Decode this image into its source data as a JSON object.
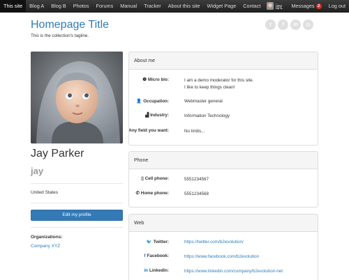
{
  "navbar": {
    "items": [
      "This site",
      "Blog A",
      "Blog B",
      "Photos",
      "Forums",
      "Manual",
      "Tracker",
      "About this site",
      "Widget Page",
      "Contact"
    ],
    "user": "jay",
    "messages_label": "Messages",
    "messages_count": "2",
    "logout": "Log out"
  },
  "header": {
    "title": "Homepage Title",
    "tagline": "This is the collection's tagline."
  },
  "social_icons": [
    {
      "icon": "twitter-icon",
      "glyph": "t"
    },
    {
      "icon": "facebook-icon",
      "glyph": "f"
    },
    {
      "icon": "linkedin-icon",
      "glyph": "in"
    },
    {
      "icon": "github-icon",
      "glyph": "⚇"
    }
  ],
  "profile": {
    "name": "Jay Parker",
    "nickname": "jay",
    "country": "United States",
    "edit_button": "Edit my profile",
    "organizations_label": "Organizations:",
    "organization": "Company XYZ"
  },
  "about": {
    "heading": "About me",
    "micro_bio_label": "Micro bio:",
    "micro_bio_line1": "I am a demo moderator for this site.",
    "micro_bio_line2": "I like to keep things clean!",
    "occupation_label": "Occupation:",
    "occupation": "Webmaster general",
    "industry_label": "Industry:",
    "industry": "Information Technology",
    "any_field_label": "Any field you want:",
    "any_field": "No limits..."
  },
  "phone": {
    "heading": "Phone",
    "cell_label": "Cell phone:",
    "cell": "5551234567",
    "home_label": "Home phone:",
    "home": "5551234568"
  },
  "web": {
    "heading": "Web",
    "twitter_label": "Twitter:",
    "twitter": "https://twitter.com/b2evolution/",
    "facebook_label": "Facebook:",
    "facebook": "https://www.facebook.com/b2evolution",
    "linkedin_label": "Linkedin:",
    "linkedin": "https://www.linkedin.com/company/b2evolution-net"
  }
}
